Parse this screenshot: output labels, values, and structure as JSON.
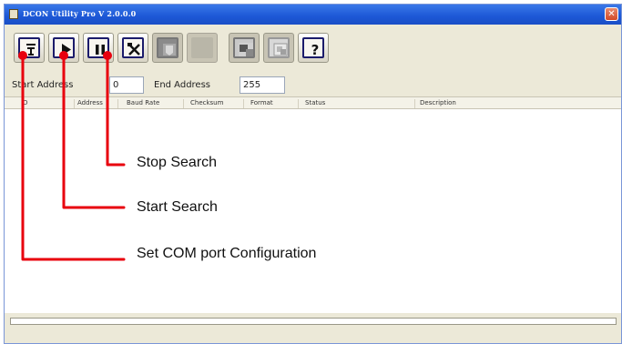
{
  "window": {
    "title": "DCON Utility Pro V 2.0.0.0",
    "close_glyph": "✕"
  },
  "toolbar": {
    "buttons": [
      {
        "name": "com-port-config-button",
        "icon": "serial-port-icon",
        "glyph": "⩧"
      },
      {
        "name": "start-search-button",
        "icon": "play-icon",
        "glyph": "▶"
      },
      {
        "name": "stop-search-button",
        "icon": "pause-icon",
        "glyph": "❚❚"
      },
      {
        "name": "tools-button",
        "icon": "tools-icon",
        "glyph": "⚒"
      },
      {
        "name": "module-image-button",
        "icon": "module-image-icon"
      },
      {
        "name": "disabled-button",
        "icon": "blank-icon"
      },
      {
        "name": "terminal-button",
        "icon": "terminal-icon"
      },
      {
        "name": "window-button",
        "icon": "window-icon"
      },
      {
        "name": "help-button",
        "icon": "help-icon",
        "glyph": "?"
      }
    ]
  },
  "address": {
    "start_label": "Start Address",
    "start_value": "0",
    "end_label": "End Address",
    "end_value": "255"
  },
  "table": {
    "columns": [
      "ID",
      "Address",
      "Baud Rate",
      "Checksum",
      "Format",
      "Status",
      "Description"
    ]
  },
  "annotations": {
    "stop_search": "Stop Search",
    "start_search": "Start Search",
    "set_com": "Set COM port Configuration",
    "line_color": "#e8000e"
  }
}
